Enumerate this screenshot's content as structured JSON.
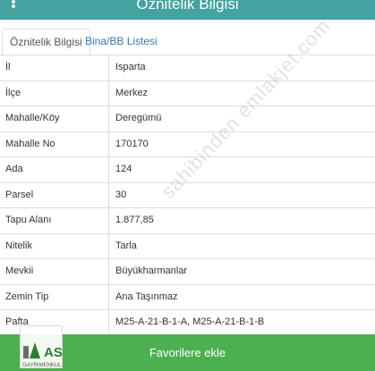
{
  "header": {
    "title": "Öznitelik Bilgisi"
  },
  "tabs": [
    {
      "label": "Öznitelik Bilgisi",
      "active": true
    },
    {
      "label": "Bina/BB Listesi",
      "active": false
    }
  ],
  "rows": [
    {
      "key": "İl",
      "value": "Isparta"
    },
    {
      "key": "İlçe",
      "value": "Merkez"
    },
    {
      "key": "Mahalle/Köy",
      "value": "Deregümü"
    },
    {
      "key": "Mahalle No",
      "value": "170170"
    },
    {
      "key": "Ada",
      "value": "124"
    },
    {
      "key": "Parsel",
      "value": "30"
    },
    {
      "key": "Tapu Alanı",
      "value": "1.877,85"
    },
    {
      "key": "Nitelik",
      "value": "Tarla"
    },
    {
      "key": "Mevkii",
      "value": "Büyükharmanlar"
    },
    {
      "key": "Zemin Tip",
      "value": "Ana Taşınmaz"
    },
    {
      "key": "Pafta",
      "value": "M25-A-21-B-1-A, M25-A-21-B-1-B"
    }
  ],
  "watermark": "sahibinden emlakjet.com",
  "favorite_button": {
    "label": "Favorilere ekle"
  },
  "logo": {
    "text": "AS",
    "subtext": "GAYRIMENKUL"
  },
  "colors": {
    "header": "#44a2a0",
    "button": "#4caf50",
    "link": "#337ab7"
  }
}
